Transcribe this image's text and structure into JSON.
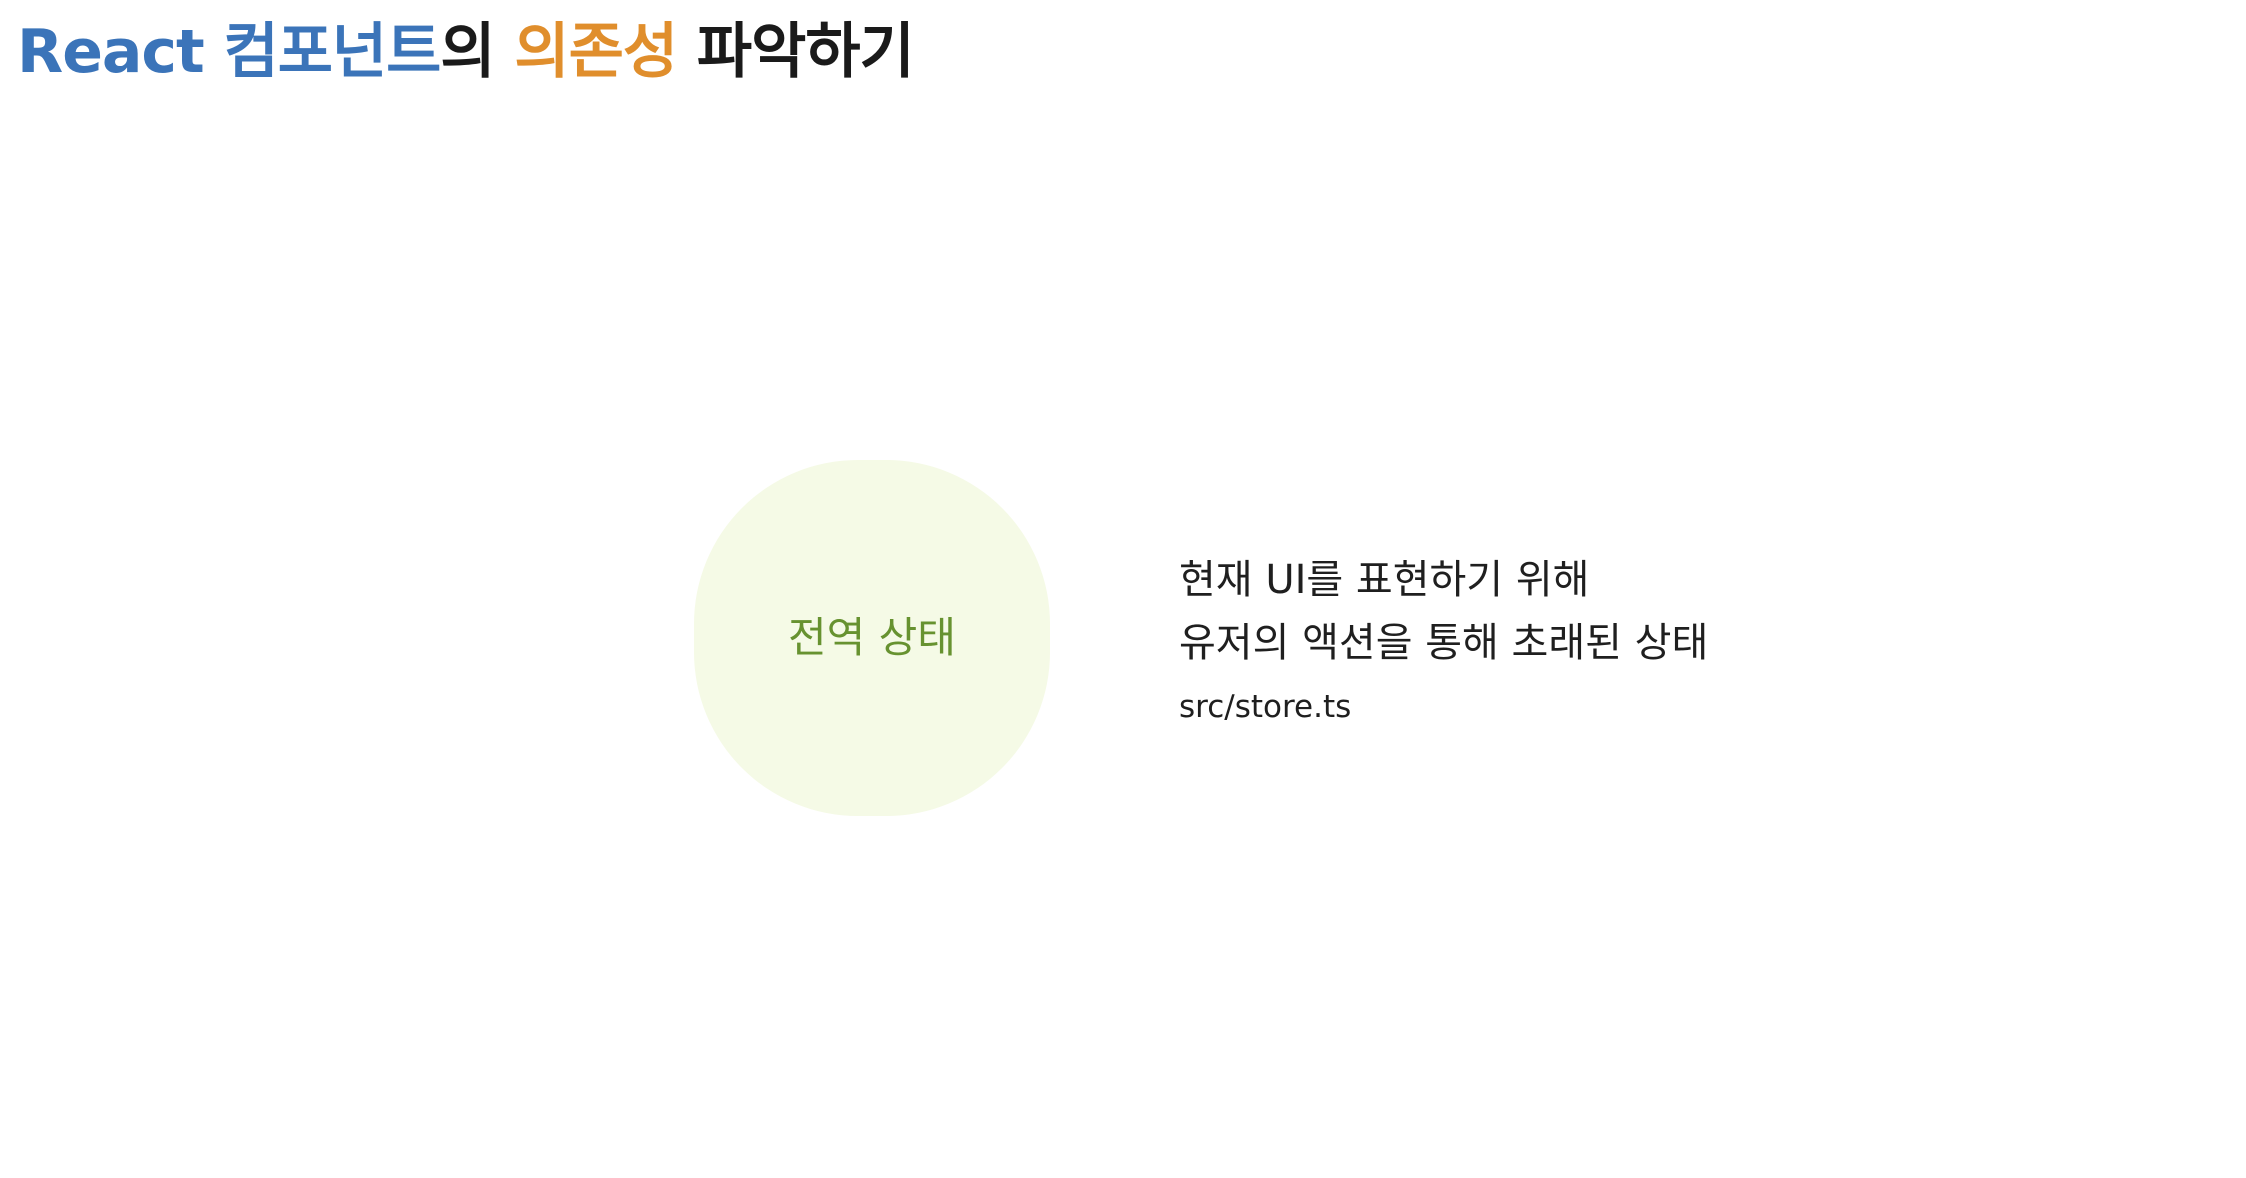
{
  "title": {
    "part1": "React 컴포넌트",
    "part2": "의 ",
    "part3": "의존성",
    "part4": " 파악하기",
    "colors": {
      "react_components": "#3b74b9",
      "dependency": "#e08e2c",
      "default": "#1a1a1a"
    }
  },
  "diagram": {
    "node": {
      "label": "전역 상태",
      "fill": "#f5fae6",
      "label_color": "#679230"
    },
    "description": {
      "line1": "현재 UI를 표현하기 위해",
      "line2": "유저의 액션을 통해 초래된 상태",
      "path": "src/store.ts"
    }
  }
}
